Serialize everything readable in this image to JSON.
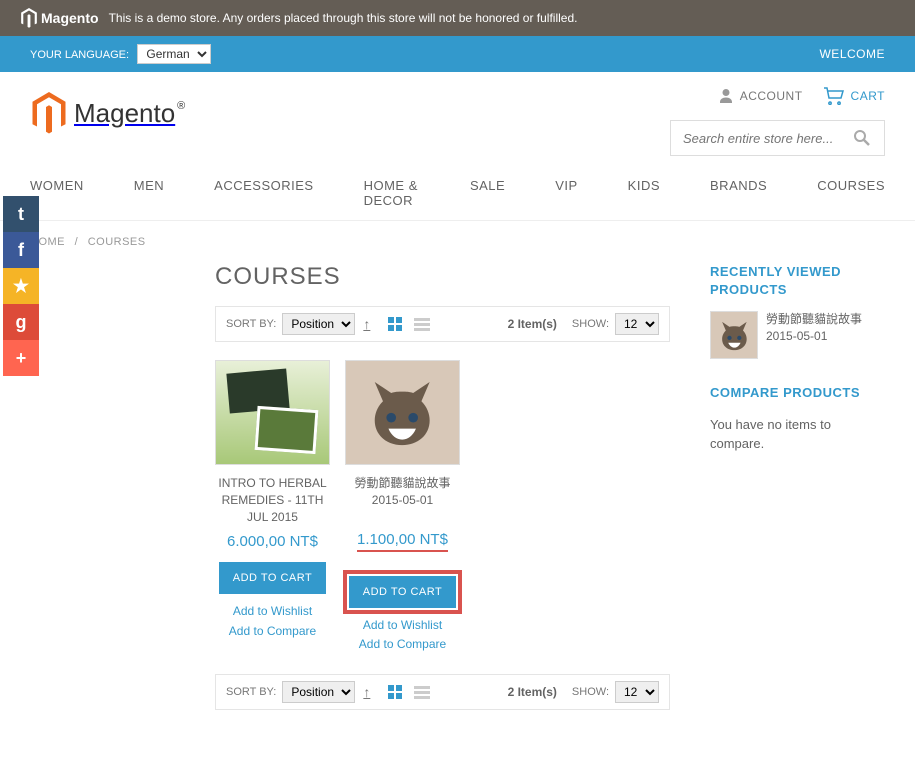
{
  "demo_notice": "This is a demo store. Any orders placed through this store will not be honored or fulfilled.",
  "brand": "Magento",
  "language": {
    "label": "YOUR LANGUAGE:",
    "selected": "German"
  },
  "welcome": "WELCOME",
  "header_links": {
    "account": "ACCOUNT",
    "cart": "CART"
  },
  "search": {
    "placeholder": "Search entire store here..."
  },
  "nav": [
    "WOMEN",
    "MEN",
    "ACCESSORIES",
    "HOME & DECOR",
    "SALE",
    "VIP",
    "KIDS",
    "BRANDS",
    "COURSES"
  ],
  "breadcrumbs": {
    "home": "HOME",
    "current": "COURSES"
  },
  "page_title": "COURSES",
  "toolbar": {
    "sort_by_label": "SORT BY:",
    "sort_by_value": "Position",
    "item_count": "2 Item(s)",
    "show_label": "SHOW:",
    "show_value": "12"
  },
  "products": [
    {
      "name": "INTRO TO HERBAL REMEDIES - 11TH JUL 2015",
      "price": "6.000,00 NT$",
      "add_cart": "ADD TO CART",
      "wishlist": "Add to Wishlist",
      "compare": "Add to Compare"
    },
    {
      "name": "勞動節聽貓說故事 2015-05-01",
      "price": "1.100,00 NT$",
      "add_cart": "ADD TO CART",
      "wishlist": "Add to Wishlist",
      "compare": "Add to Compare"
    }
  ],
  "sidebar": {
    "recent_title": "RECENTLY VIEWED PRODUCTS",
    "recent_item": "勞動節聽貓說故事 2015-05-01",
    "compare_title": "COMPARE PRODUCTS",
    "compare_empty": "You have no items to compare."
  }
}
